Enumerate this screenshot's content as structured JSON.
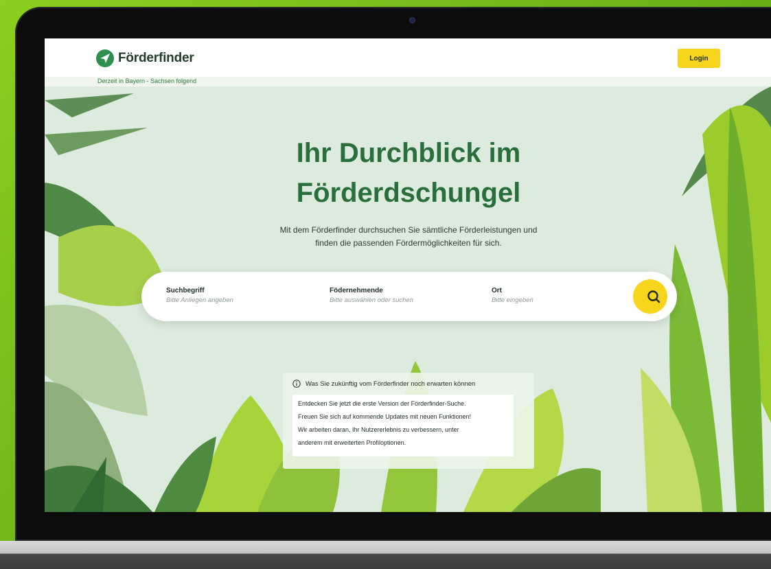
{
  "header": {
    "logo_text": "Förderfinder",
    "login_label": "Login",
    "region_note": "Derzeit in Bayern - Sachsen folgend"
  },
  "hero": {
    "title_line1": "Ihr Durchblick im",
    "title_line2": "Förderdschungel",
    "subtitle_line1": "Mit dem Förderfinder durchsuchen Sie sämtliche Förderleistungen und",
    "subtitle_line2": "finden die passenden Fördermöglichkeiten für sich."
  },
  "search": {
    "fields": [
      {
        "label": "Suchbegriff",
        "placeholder": "Bitte Anliegen angeben"
      },
      {
        "label": "Födernehmende",
        "placeholder": "Bitte auswählen oder suchen"
      },
      {
        "label": "Ort",
        "placeholder": "Bitte eingeben"
      }
    ],
    "button_icon": "search-icon"
  },
  "info": {
    "title": "Was Sie zukünftig vom Förderfinder noch erwarten können",
    "lines": [
      "Entdecken Sie jetzt die erste Version der Förderfinder-Suche.",
      "Freuen Sie sich auf kommende Updates mit neuen Funktionen!",
      "Wir arbeiten daran, Ihr Nutzererlebnis zu verbessern, unter",
      "anderem mit erweiterten Profiloptionen."
    ],
    "icon": "info-circle-icon"
  },
  "colors": {
    "brand_green": "#2b6e3d",
    "accent_yellow": "#f6d51c",
    "screen_bg": "#dcebde",
    "outer_bg": "#7cc21c"
  }
}
